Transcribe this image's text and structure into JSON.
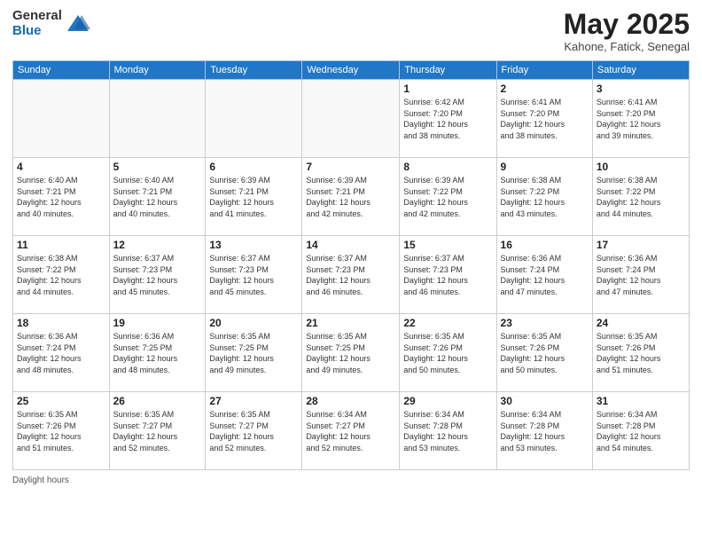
{
  "logo": {
    "general": "General",
    "blue": "Blue"
  },
  "title": "May 2025",
  "subtitle": "Kahone, Fatick, Senegal",
  "days_of_week": [
    "Sunday",
    "Monday",
    "Tuesday",
    "Wednesday",
    "Thursday",
    "Friday",
    "Saturday"
  ],
  "footer": "Daylight hours",
  "weeks": [
    [
      {
        "day": "",
        "info": ""
      },
      {
        "day": "",
        "info": ""
      },
      {
        "day": "",
        "info": ""
      },
      {
        "day": "",
        "info": ""
      },
      {
        "day": "1",
        "info": "Sunrise: 6:42 AM\nSunset: 7:20 PM\nDaylight: 12 hours\nand 38 minutes."
      },
      {
        "day": "2",
        "info": "Sunrise: 6:41 AM\nSunset: 7:20 PM\nDaylight: 12 hours\nand 38 minutes."
      },
      {
        "day": "3",
        "info": "Sunrise: 6:41 AM\nSunset: 7:20 PM\nDaylight: 12 hours\nand 39 minutes."
      }
    ],
    [
      {
        "day": "4",
        "info": "Sunrise: 6:40 AM\nSunset: 7:21 PM\nDaylight: 12 hours\nand 40 minutes."
      },
      {
        "day": "5",
        "info": "Sunrise: 6:40 AM\nSunset: 7:21 PM\nDaylight: 12 hours\nand 40 minutes."
      },
      {
        "day": "6",
        "info": "Sunrise: 6:39 AM\nSunset: 7:21 PM\nDaylight: 12 hours\nand 41 minutes."
      },
      {
        "day": "7",
        "info": "Sunrise: 6:39 AM\nSunset: 7:21 PM\nDaylight: 12 hours\nand 42 minutes."
      },
      {
        "day": "8",
        "info": "Sunrise: 6:39 AM\nSunset: 7:22 PM\nDaylight: 12 hours\nand 42 minutes."
      },
      {
        "day": "9",
        "info": "Sunrise: 6:38 AM\nSunset: 7:22 PM\nDaylight: 12 hours\nand 43 minutes."
      },
      {
        "day": "10",
        "info": "Sunrise: 6:38 AM\nSunset: 7:22 PM\nDaylight: 12 hours\nand 44 minutes."
      }
    ],
    [
      {
        "day": "11",
        "info": "Sunrise: 6:38 AM\nSunset: 7:22 PM\nDaylight: 12 hours\nand 44 minutes."
      },
      {
        "day": "12",
        "info": "Sunrise: 6:37 AM\nSunset: 7:23 PM\nDaylight: 12 hours\nand 45 minutes."
      },
      {
        "day": "13",
        "info": "Sunrise: 6:37 AM\nSunset: 7:23 PM\nDaylight: 12 hours\nand 45 minutes."
      },
      {
        "day": "14",
        "info": "Sunrise: 6:37 AM\nSunset: 7:23 PM\nDaylight: 12 hours\nand 46 minutes."
      },
      {
        "day": "15",
        "info": "Sunrise: 6:37 AM\nSunset: 7:23 PM\nDaylight: 12 hours\nand 46 minutes."
      },
      {
        "day": "16",
        "info": "Sunrise: 6:36 AM\nSunset: 7:24 PM\nDaylight: 12 hours\nand 47 minutes."
      },
      {
        "day": "17",
        "info": "Sunrise: 6:36 AM\nSunset: 7:24 PM\nDaylight: 12 hours\nand 47 minutes."
      }
    ],
    [
      {
        "day": "18",
        "info": "Sunrise: 6:36 AM\nSunset: 7:24 PM\nDaylight: 12 hours\nand 48 minutes."
      },
      {
        "day": "19",
        "info": "Sunrise: 6:36 AM\nSunset: 7:25 PM\nDaylight: 12 hours\nand 48 minutes."
      },
      {
        "day": "20",
        "info": "Sunrise: 6:35 AM\nSunset: 7:25 PM\nDaylight: 12 hours\nand 49 minutes."
      },
      {
        "day": "21",
        "info": "Sunrise: 6:35 AM\nSunset: 7:25 PM\nDaylight: 12 hours\nand 49 minutes."
      },
      {
        "day": "22",
        "info": "Sunrise: 6:35 AM\nSunset: 7:26 PM\nDaylight: 12 hours\nand 50 minutes."
      },
      {
        "day": "23",
        "info": "Sunrise: 6:35 AM\nSunset: 7:26 PM\nDaylight: 12 hours\nand 50 minutes."
      },
      {
        "day": "24",
        "info": "Sunrise: 6:35 AM\nSunset: 7:26 PM\nDaylight: 12 hours\nand 51 minutes."
      }
    ],
    [
      {
        "day": "25",
        "info": "Sunrise: 6:35 AM\nSunset: 7:26 PM\nDaylight: 12 hours\nand 51 minutes."
      },
      {
        "day": "26",
        "info": "Sunrise: 6:35 AM\nSunset: 7:27 PM\nDaylight: 12 hours\nand 52 minutes."
      },
      {
        "day": "27",
        "info": "Sunrise: 6:35 AM\nSunset: 7:27 PM\nDaylight: 12 hours\nand 52 minutes."
      },
      {
        "day": "28",
        "info": "Sunrise: 6:34 AM\nSunset: 7:27 PM\nDaylight: 12 hours\nand 52 minutes."
      },
      {
        "day": "29",
        "info": "Sunrise: 6:34 AM\nSunset: 7:28 PM\nDaylight: 12 hours\nand 53 minutes."
      },
      {
        "day": "30",
        "info": "Sunrise: 6:34 AM\nSunset: 7:28 PM\nDaylight: 12 hours\nand 53 minutes."
      },
      {
        "day": "31",
        "info": "Sunrise: 6:34 AM\nSunset: 7:28 PM\nDaylight: 12 hours\nand 54 minutes."
      }
    ]
  ]
}
